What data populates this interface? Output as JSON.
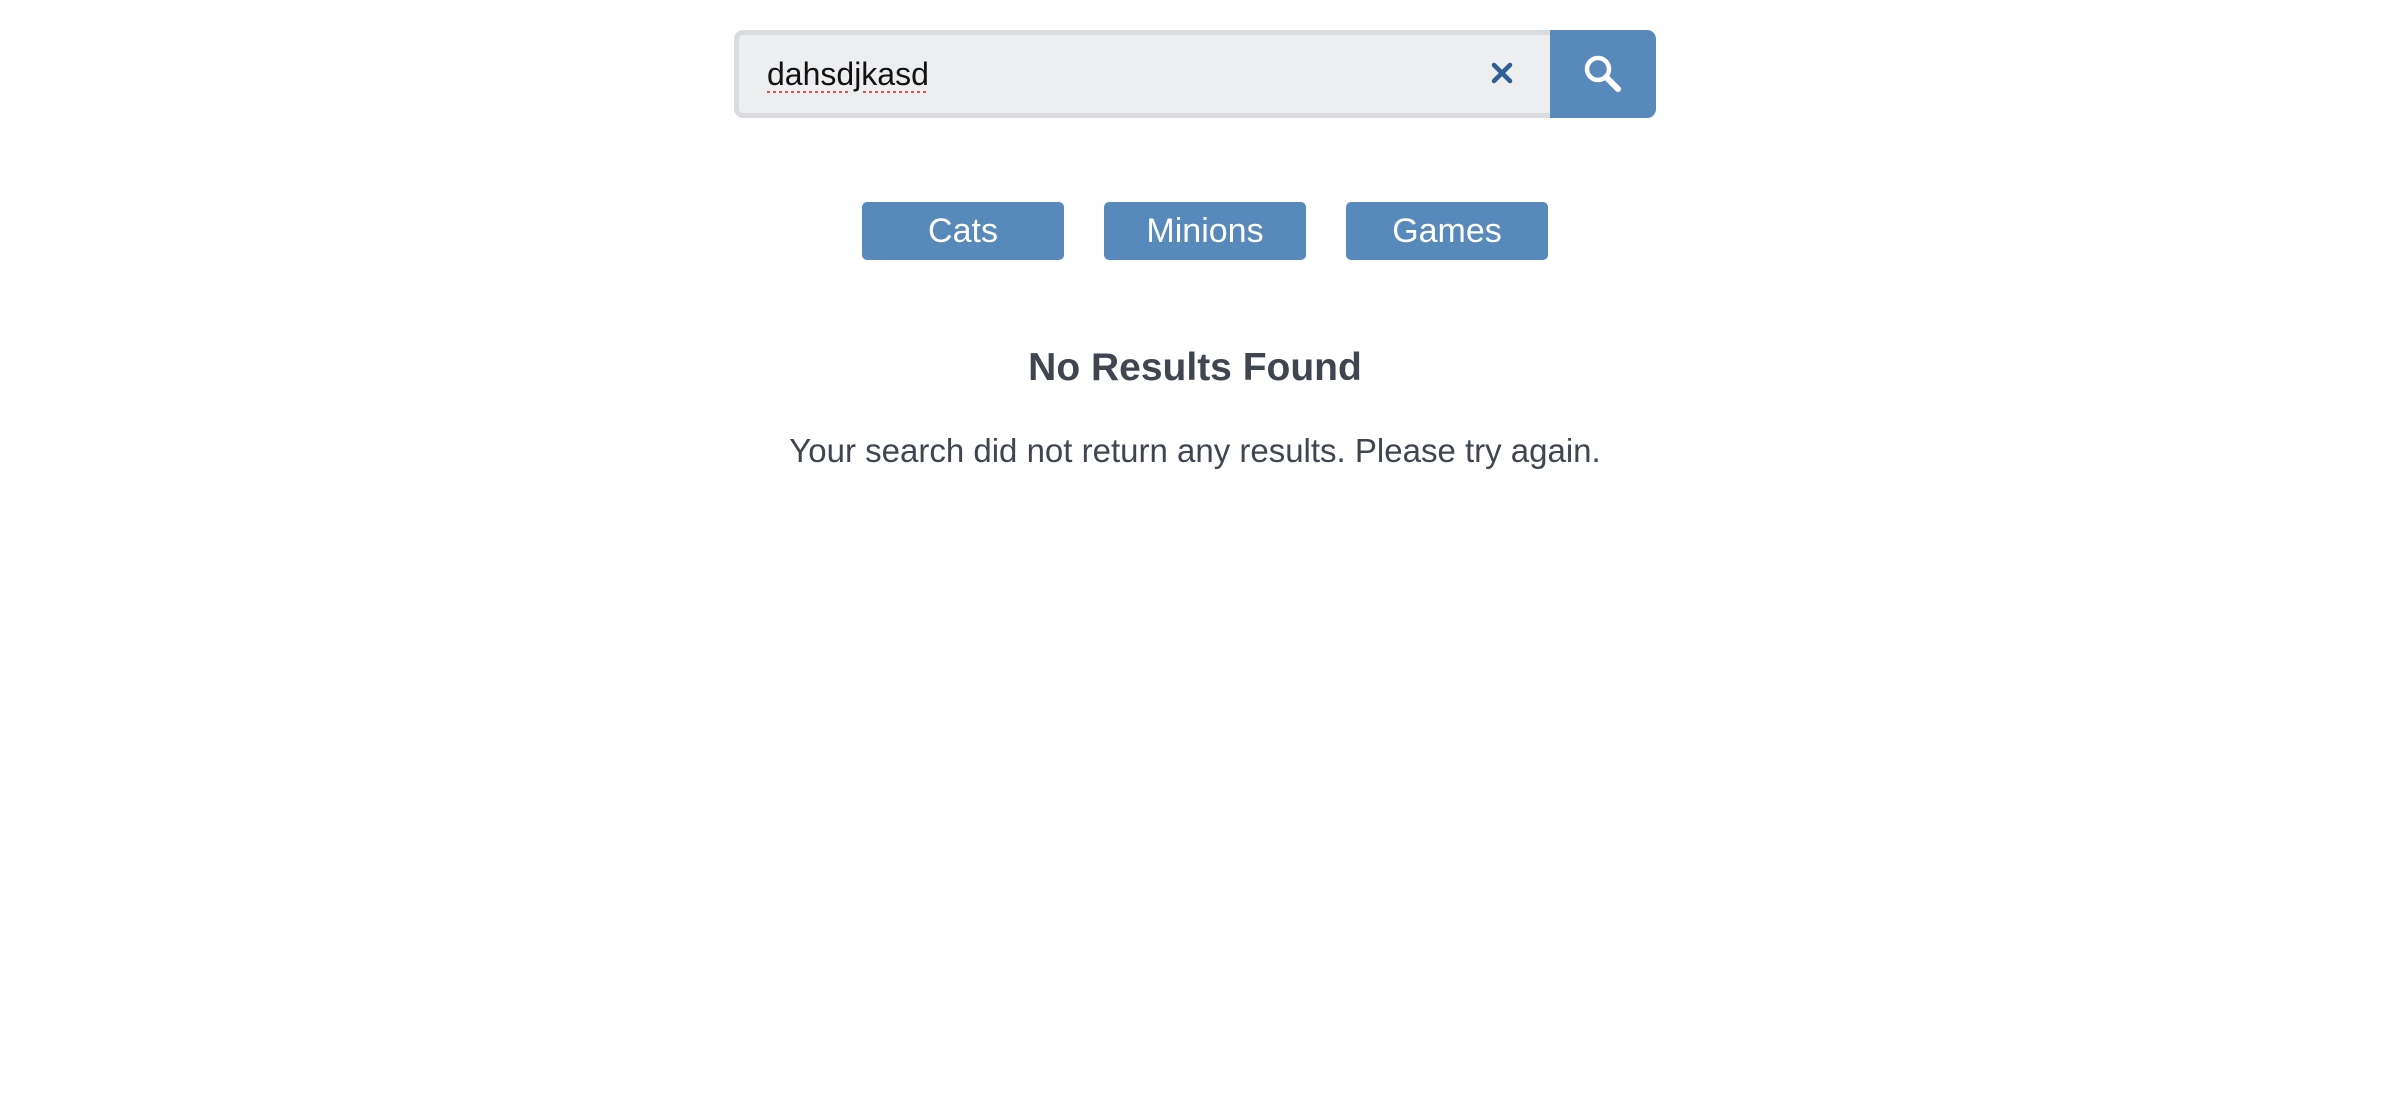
{
  "search": {
    "value": "dahsdjkasd",
    "clear_icon": "close-icon",
    "search_icon": "search-icon"
  },
  "categories": [
    {
      "label": "Cats"
    },
    {
      "label": "Minions"
    },
    {
      "label": "Games"
    }
  ],
  "results": {
    "title": "No Results Found",
    "message": "Your search did not return any results. Please try again."
  },
  "colors": {
    "accent": "#5889bb",
    "input_background": "#edeef0",
    "input_border": "#d9dbde",
    "text": "#3f4650",
    "clear_icon": "#2f5f94"
  }
}
